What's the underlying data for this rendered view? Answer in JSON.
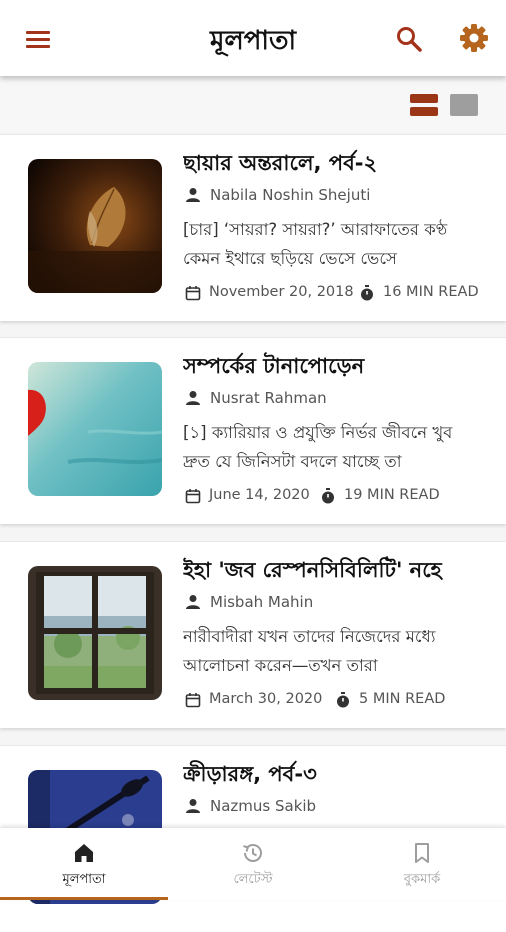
{
  "app_bar": {
    "title": "মূলপাতা",
    "menu_icon": "menu-icon",
    "search_icon": "search-icon",
    "settings_icon": "gear-icon",
    "accent_color": "#a3331a"
  },
  "view_toggle": {
    "list_icon": "list-view-icon",
    "grid_icon": "grid-view-icon",
    "selected": "list"
  },
  "articles": [
    {
      "title": "ছায়ার অন্তরালে, পর্ব-২",
      "author": "Nabila Noshin Shejuti",
      "excerpt": "[চার]  ‘সায়রা? সায়রা?’ আরাফাতের কণ্ঠ কেমন ইথারে ছড়িয়ে ভেসে ভেসে",
      "date": "November 20, 2018",
      "read_time": "16 MIN READ"
    },
    {
      "title": "সম্পর্কের টানাপোড়েন",
      "author": "Nusrat Rahman",
      "excerpt": "[১]  ক্যারিয়ার ও প্রযুক্তি নির্ভর জীবনে খুব দ্রুত যে জিনিসটা বদলে যাচ্ছে তা",
      "date": "June 14, 2020",
      "read_time": "19 MIN READ"
    },
    {
      "title": "ইহা 'জব রেস্পনসিবিলিটি' নহে",
      "author": "Misbah Mahin",
      "excerpt": "নারীবাদীরা যখন তাদের নিজেদের মধ্যে আলোচনা করেন—তখন তারা",
      "date": "March 30, 2020",
      "read_time": "5 MIN READ"
    },
    {
      "title": "ক্রীড়ারঙ্গ, পর্ব-৩",
      "author": "Nazmus Sakib",
      "excerpt": "",
      "date": "",
      "read_time": ""
    }
  ],
  "bottom_nav": {
    "items": [
      {
        "label": "মূলপাতা",
        "icon": "home-icon",
        "active": true
      },
      {
        "label": "লেটেস্ট",
        "icon": "history-icon",
        "active": false
      },
      {
        "label": "বুকমার্ক",
        "icon": "bookmark-icon",
        "active": false
      }
    ],
    "active_color": "#b5651d"
  }
}
